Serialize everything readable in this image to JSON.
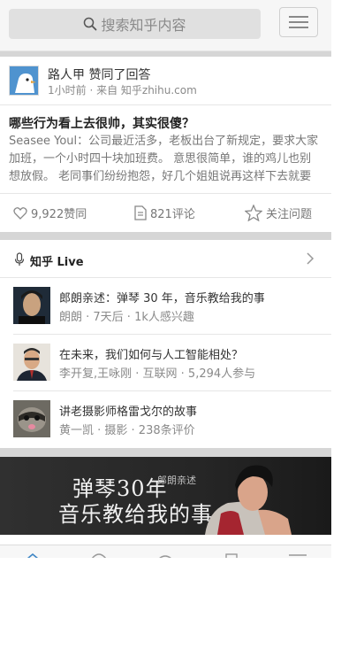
{
  "header": {
    "search_placeholder": "搜索知乎内容",
    "menu_icon": "hamburger-menu-icon"
  },
  "feed": {
    "actor": "路人甲 赞同了回答",
    "meta": "1小时前 · 来自 知乎zhihu.com",
    "question": "哪些行为看上去很帅，其实很傻？",
    "excerpt": "Seasee Youl：公司最近活多，老板出台了新规定，要求大家加班，一个小时四十块加班费。 意思很简单，谁的鸡儿也别想放假。 老同事们纷纷抱怨，好几个姐姐说再这样下去就要辞职了",
    "actions": {
      "votes": "9,922赞同",
      "comments": "821评论",
      "follow": "关注问题"
    }
  },
  "live": {
    "title": "知乎 Live",
    "items": [
      {
        "title": "郎朗亲述：弹琴 30 年，音乐教给我的事",
        "meta": "朗朗 · 7天后 · 1k人感兴趣"
      },
      {
        "title": "在未来，我们如何与人工智能相处？",
        "meta": "李开复,王咏刚 · 互联网 · 5,294人参与"
      },
      {
        "title": "讲老摄影师格雷戈尔的故事",
        "meta": "黄一凯 · 摄影 · 238条评价"
      }
    ]
  },
  "banner": {
    "line1": "弹琴30年",
    "line2": "音乐教给我的事",
    "tag": "郎朗亲述"
  },
  "colors": {
    "header_bg": "#f6f6f6",
    "search_bg": "#e0e0e0",
    "section_gap": "#d6d6d6",
    "tab_active": "#3e86c5"
  }
}
